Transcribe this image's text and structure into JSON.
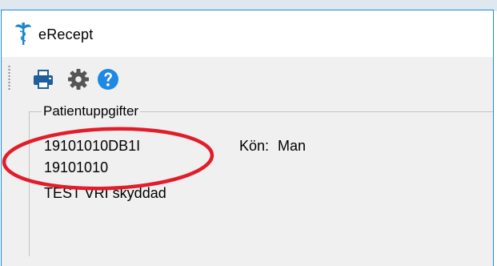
{
  "window": {
    "title": "eRecept",
    "icon": "caduceus-icon"
  },
  "toolbar": {
    "buttons": [
      {
        "name": "print",
        "icon": "printer-icon",
        "color": "#1f5f9e"
      },
      {
        "name": "settings",
        "icon": "gear-icon",
        "color": "#555555"
      },
      {
        "name": "help",
        "icon": "question-circle-icon",
        "color": "#1e88e5"
      }
    ]
  },
  "patient": {
    "group_title": "Patientuppgifter",
    "id": "19101010DB1I",
    "id_short": "19101010",
    "name": "TEST VRI skyddad",
    "sex_label": "Kön:",
    "sex_value": "Man"
  },
  "colors": {
    "accent": "#1e8bd6",
    "annotation": "#e21d2a"
  }
}
